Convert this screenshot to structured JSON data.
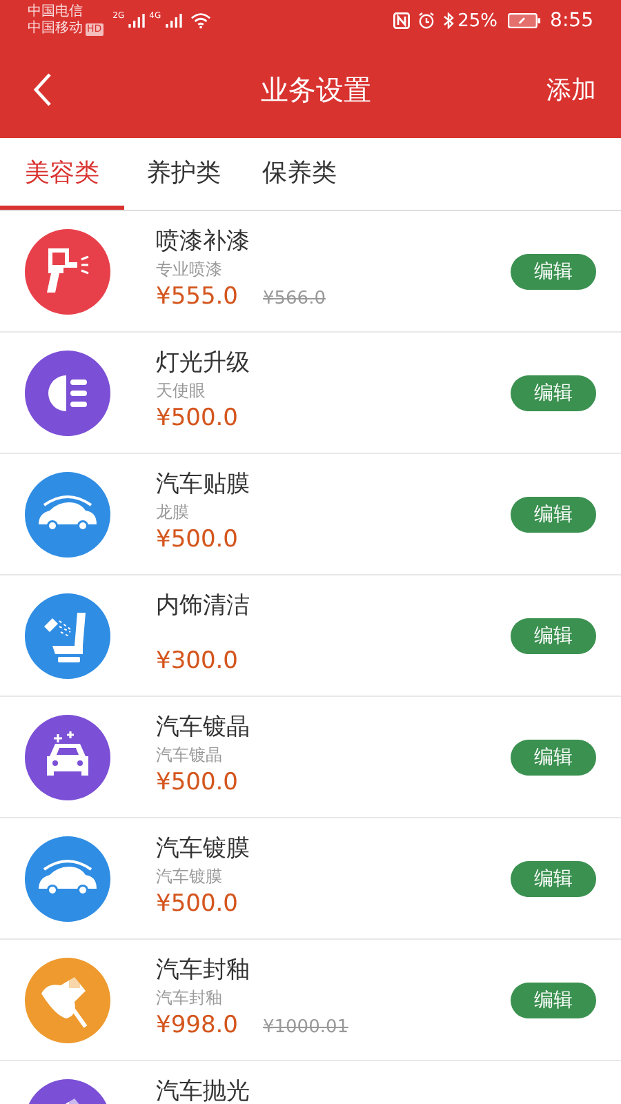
{
  "status_bar": {
    "carrier_1": "中国电信",
    "carrier_2": "中国移动",
    "hd": "HD",
    "net_1": "2G",
    "net_2": "4G",
    "battery": "25%",
    "time": "8:55"
  },
  "header": {
    "title": "业务设置",
    "action": "添加"
  },
  "tabs": [
    {
      "label": "美容类",
      "selected": true
    },
    {
      "label": "养护类",
      "selected": false
    },
    {
      "label": "保养类",
      "selected": false
    }
  ],
  "services": [
    {
      "kind": "spray",
      "color": "#e8404a",
      "title": "喷漆补漆",
      "subtitle": "专业喷漆",
      "price": "¥555.0",
      "original_price": "¥566.0",
      "button": "编辑"
    },
    {
      "kind": "headlight",
      "color": "#7b4fd6",
      "title": "灯光升级",
      "subtitle": "天使眼",
      "price": "¥500.0",
      "button": "编辑"
    },
    {
      "kind": "car",
      "color": "#2f8de4",
      "title": "汽车贴膜",
      "subtitle": "龙膜",
      "price": "¥500.0",
      "button": "编辑"
    },
    {
      "kind": "seat",
      "color": "#2f8de4",
      "title": "内饰清洁",
      "price": "¥300.0",
      "button": "编辑"
    },
    {
      "kind": "car_front",
      "color": "#7b4fd6",
      "title": "汽车镀晶",
      "subtitle": "汽车镀晶",
      "price": "¥500.0",
      "button": "编辑"
    },
    {
      "kind": "car",
      "color": "#2f8de4",
      "title": "汽车镀膜",
      "subtitle": "汽车镀膜",
      "price": "¥500.0",
      "button": "编辑"
    },
    {
      "kind": "polisher",
      "color": "#ee9a2e",
      "title": "汽车封釉",
      "subtitle": "汽车封釉",
      "price": "¥998.0",
      "original_price": "¥1000.01",
      "button": "编辑"
    },
    {
      "kind": "polisher",
      "color": "#7b4fd6",
      "title": "汽车抛光"
    }
  ]
}
